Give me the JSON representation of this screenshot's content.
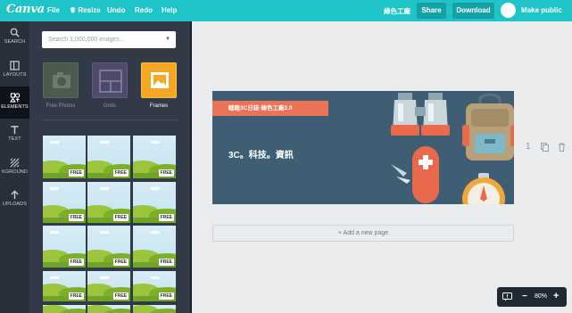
{
  "app": {
    "logo": "Canva"
  },
  "menu": {
    "file": "File",
    "resize": "Resize",
    "undo": "Undo",
    "redo": "Redo",
    "help": "Help"
  },
  "topbar": {
    "design_title": "綠色工廠",
    "share_label": "Share",
    "download_label": "Download",
    "make_public_label": "Make public"
  },
  "rail": {
    "search": "SEARCH",
    "layouts": "LAYOUTS",
    "elements": "ELEMENTS",
    "text": "TEXT",
    "background": "KGROUND",
    "uploads": "UPLOADS"
  },
  "panel": {
    "search_placeholder": "Search 1,000,000 images...",
    "categories": [
      {
        "label": "Free Photos"
      },
      {
        "label": "Grids"
      },
      {
        "label": "Frames"
      }
    ],
    "free_badge": "FREE"
  },
  "canvas": {
    "banner_text": "睦睦3C日誌-綠色工廠2.0",
    "tagline": "3C。科技。資訊",
    "page_number": "1",
    "add_page_label": "+ Add a new page"
  },
  "zoom": {
    "minus": "−",
    "level": "80%",
    "plus": "+"
  },
  "colors": {
    "topbar": "#1fc4c8",
    "button": "#14a2a6",
    "rail": "#293039",
    "panel": "#313a46",
    "canvas_bg": "#3f5e73",
    "banner": "#ea7355"
  }
}
